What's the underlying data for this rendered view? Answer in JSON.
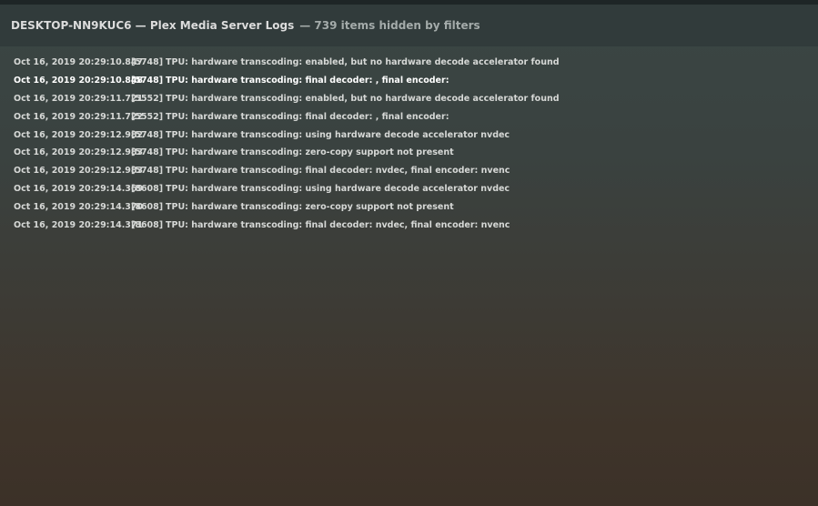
{
  "header": {
    "title": "DESKTOP-NN9KUC6 — Plex Media Server Logs",
    "hidden_note": "— 739 items hidden by filters"
  },
  "log_entries": [
    {
      "time": "Oct 16, 2019 20:29:10.847",
      "pid": "[5748]",
      "message": "TPU: hardware transcoding: enabled, but no hardware decode accelerator found"
    },
    {
      "time": "Oct 16, 2019 20:29:10.848",
      "pid": "[5748]",
      "message": "TPU: hardware transcoding: final decoder: , final encoder:"
    },
    {
      "time": "Oct 16, 2019 20:29:11.721",
      "pid": "[5552]",
      "message": "TPU: hardware transcoding: enabled, but no hardware decode accelerator found"
    },
    {
      "time": "Oct 16, 2019 20:29:11.722",
      "pid": "[5552]",
      "message": "TPU: hardware transcoding: final decoder: , final encoder:"
    },
    {
      "time": "Oct 16, 2019 20:29:12.982",
      "pid": "[5748]",
      "message": "TPU: hardware transcoding: using hardware decode accelerator nvdec"
    },
    {
      "time": "Oct 16, 2019 20:29:12.983",
      "pid": "[5748]",
      "message": "TPU: hardware transcoding: zero-copy support not present"
    },
    {
      "time": "Oct 16, 2019 20:29:12.983",
      "pid": "[5748]",
      "message": "TPU: hardware transcoding: final decoder: nvdec, final encoder: nvenc"
    },
    {
      "time": "Oct 16, 2019 20:29:14.369",
      "pid": "[8608]",
      "message": "TPU: hardware transcoding: using hardware decode accelerator nvdec"
    },
    {
      "time": "Oct 16, 2019 20:29:14.370",
      "pid": "[8608]",
      "message": "TPU: hardware transcoding: zero-copy support not present"
    },
    {
      "time": "Oct 16, 2019 20:29:14.371",
      "pid": "[8608]",
      "message": "TPU: hardware transcoding: final decoder: nvdec, final encoder: nvenc"
    }
  ]
}
